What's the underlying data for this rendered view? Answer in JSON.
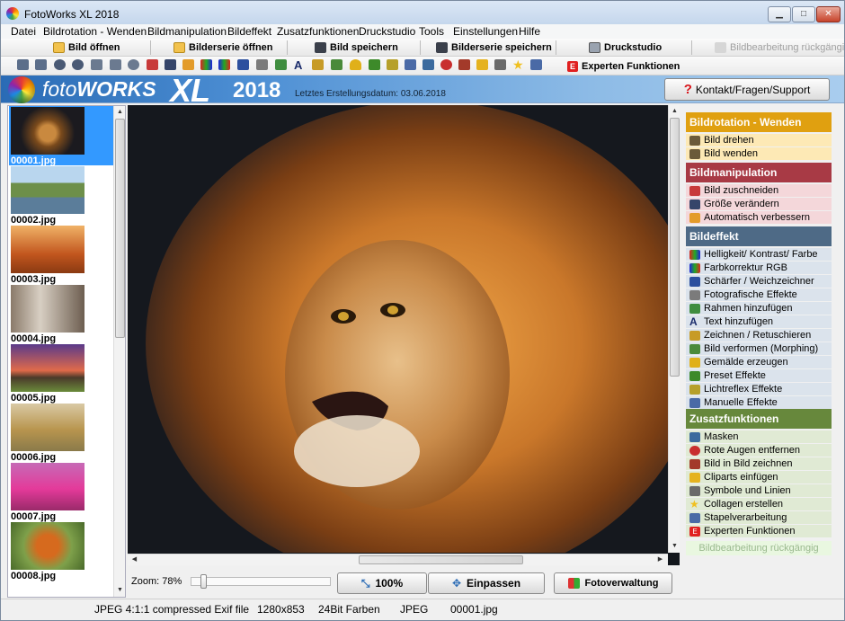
{
  "window": {
    "title": "FotoWorks XL 2018"
  },
  "menu": [
    "Datei",
    "Bildrotation - Wenden",
    "Bildmanipulation",
    "Bildeffekt",
    "Zusatzfunktionen",
    "Druckstudio",
    "Tools",
    "Einstellungen",
    "Hilfe"
  ],
  "toolbar": {
    "open": "Bild öffnen",
    "open_series": "Bilderserie öffnen",
    "save": "Bild speichern",
    "save_series": "Bilderserie speichern",
    "print_studio": "Druckstudio",
    "undo": "Bildbearbeitung rückgängi"
  },
  "toolbar2": {
    "expert_label": "Experten Funktionen"
  },
  "banner": {
    "logo_foto": "foto",
    "logo_works": "WORKS",
    "logo_xl": "XL",
    "logo_year": "2018",
    "last_created": "Letztes Erstellungsdatum: 03.06.2018",
    "support": "Kontakt/Fragen/Support"
  },
  "thumbnails": [
    "00001.jpg",
    "00002.jpg",
    "00003.jpg",
    "00004.jpg",
    "00005.jpg",
    "00006.jpg",
    "00007.jpg",
    "00008.jpg"
  ],
  "zoom": {
    "label": "Zoom: 78%",
    "btn_100": "100%",
    "btn_fit": "Einpassen",
    "btn_manage": "Fotoverwaltung"
  },
  "panel": {
    "rotation": {
      "title": "Bildrotation - Wenden",
      "items": [
        "Bild drehen",
        "Bild wenden"
      ]
    },
    "manipulation": {
      "title": "Bildmanipulation",
      "items": [
        "Bild zuschneiden",
        "Größe verändern",
        "Automatisch verbessern"
      ]
    },
    "effect": {
      "title": "Bildeffekt",
      "items": [
        "Helligkeit/ Kontrast/ Farbe",
        "Farbkorrektur RGB",
        "Schärfer / Weichzeichner",
        "Fotografische Effekte",
        "Rahmen hinzufügen",
        "Text hinzufügen",
        "Zeichnen / Retuschieren",
        "Bild verformen (Morphing)",
        "Gemälde erzeugen",
        "Preset Effekte",
        "Lichtreflex Effekte",
        "Manuelle Effekte"
      ]
    },
    "extra": {
      "title": "Zusatzfunktionen",
      "items": [
        "Masken",
        "Rote Augen entfernen",
        "Bild in Bild zeichnen",
        "Cliparts einfügen",
        "Symbole und Linien",
        "Collagen erstellen",
        "Stapelverarbeitung",
        "Experten Funktionen"
      ]
    },
    "undo": "Bildbearbeitung rückgängig"
  },
  "status": {
    "format": "JPEG 4:1:1 compressed Exif file",
    "size": "1280x853",
    "depth": "24Bit Farben",
    "type": "JPEG",
    "file": "00001.jpg"
  },
  "colors": {
    "rotation": "#e0a010",
    "manipulation": "#a83a45",
    "effect": "#4e6a86",
    "extra": "#67883c",
    "selection": "#3399ff"
  }
}
